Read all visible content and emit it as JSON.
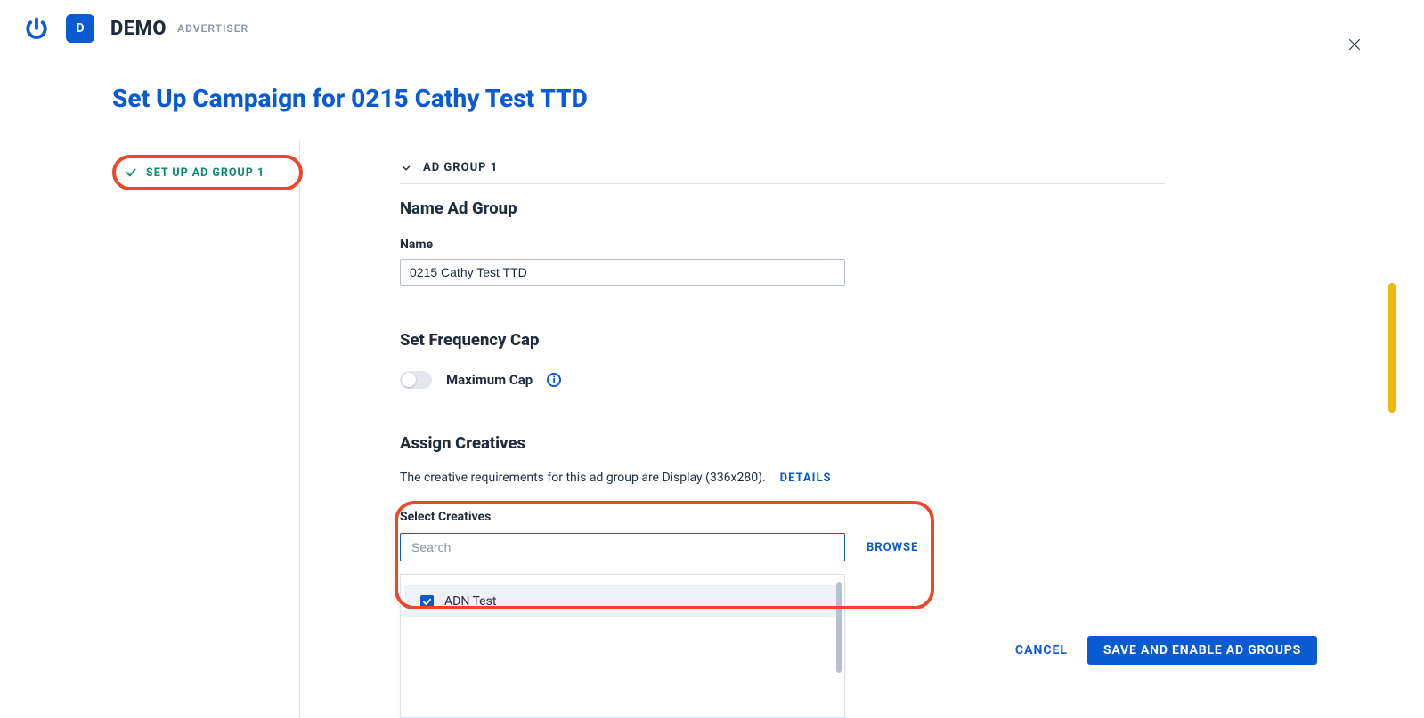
{
  "header": {
    "badge_letter": "D",
    "demo_label": "DEMO",
    "advertiser_label": "ADVERTISER"
  },
  "page_title": "Set Up Campaign for 0215 Cathy Test TTD",
  "sidebar": {
    "step_label": "SET UP AD GROUP 1"
  },
  "section": {
    "header_label": "AD GROUP 1",
    "name_heading": "Name Ad Group",
    "name_label": "Name",
    "name_value": "0215 Cathy Test TTD",
    "freq_heading": "Set Frequency Cap",
    "freq_toggle_label": "Maximum Cap",
    "creatives_heading": "Assign Creatives",
    "creatives_helper": "The creative requirements for this ad group are Display (336x280).",
    "details_label": "DETAILS",
    "select_label": "Select Creatives",
    "search_placeholder": "Search",
    "browse_label": "BROWSE",
    "dropdown_item_label": "ADN Test"
  },
  "footer": {
    "cancel_label": "CANCEL",
    "save_label": "SAVE AND ENABLE AD GROUPS"
  }
}
